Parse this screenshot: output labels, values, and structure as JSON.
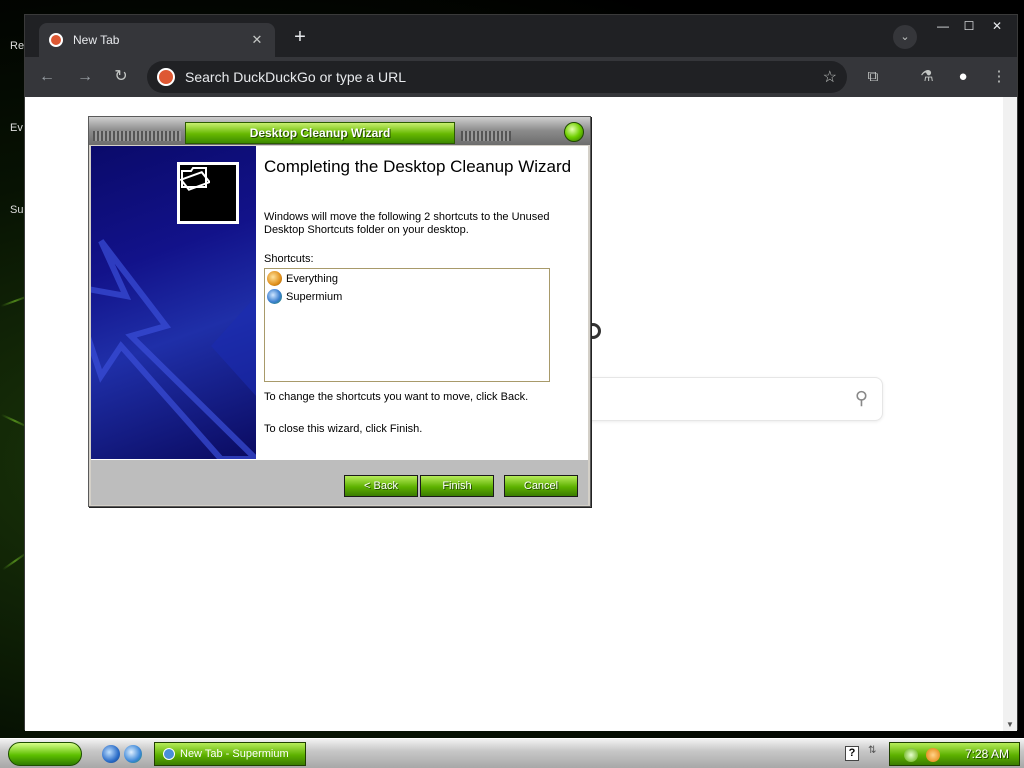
{
  "desktop": {
    "labels": [
      "Re",
      "Ev",
      "Su"
    ]
  },
  "browser": {
    "tab": {
      "title": "New Tab",
      "close_glyph": "✕"
    },
    "newtab_glyph": "+",
    "tabsearch_glyph": "⌄",
    "window_controls": {
      "minimize": "—",
      "maximize": "☐",
      "close": "✕"
    },
    "toolbar": {
      "back_glyph": "←",
      "forward_glyph": "→",
      "reload_glyph": "↻",
      "omnibox_placeholder": "Search DuckDuckGo or type a URL",
      "star_glyph": "☆",
      "extensions_glyph": "⧉",
      "labs_glyph": "⚗",
      "profile_glyph": "●",
      "menu_glyph": "⋮"
    },
    "page": {
      "search_glyph": "⚲"
    }
  },
  "wizard": {
    "title": "Desktop Cleanup Wizard",
    "heading": "Completing the Desktop Cleanup Wizard",
    "description": "Windows will move the following 2 shortcuts to the Unused Desktop Shortcuts folder on your desktop.",
    "shortcuts_label": "Shortcuts:",
    "shortcuts": [
      {
        "name": "Everything",
        "icon": "everything-icon",
        "color": "#e0901c"
      },
      {
        "name": "Supermium",
        "icon": "supermium-icon",
        "color": "#3b7fd0"
      }
    ],
    "back_hint": "To change the shortcuts you want to move, click Back.",
    "finish_hint": "To close this wizard, click Finish.",
    "buttons": {
      "back": "< Back",
      "finish": "Finish",
      "cancel": "Cancel"
    }
  },
  "taskbar": {
    "task_item": "New Tab - Supermium",
    "help_glyph": "?",
    "clock": "7:28 AM"
  },
  "colors": {
    "accent_green": "#5db100",
    "wizard_side": "#12128a",
    "ddg_orange": "#de5833"
  }
}
